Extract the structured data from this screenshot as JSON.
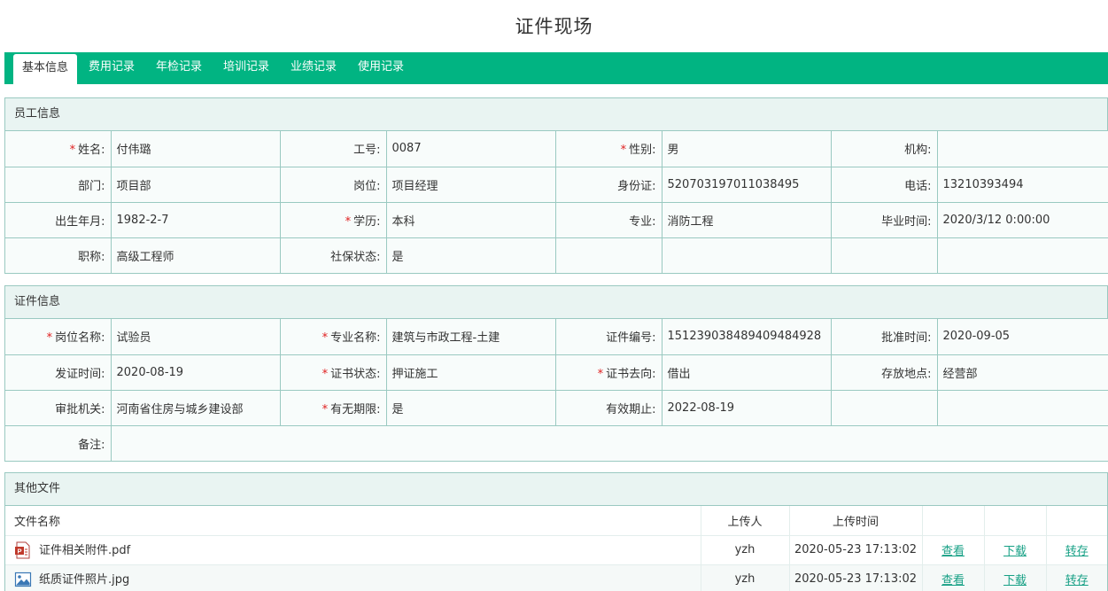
{
  "page": {
    "title": "证件现场"
  },
  "tabs": [
    {
      "label": "基本信息"
    },
    {
      "label": "费用记录"
    },
    {
      "label": "年检记录"
    },
    {
      "label": "培训记录"
    },
    {
      "label": "业绩记录"
    },
    {
      "label": "使用记录"
    }
  ],
  "employee": {
    "title": "员工信息",
    "rows": [
      [
        {
          "label": "姓名:",
          "value": "付伟璐",
          "required": true
        },
        {
          "label": "工号:",
          "value": "0087"
        },
        {
          "label": "性别:",
          "value": "男",
          "required": true
        },
        {
          "label": "机构:",
          "value": ""
        }
      ],
      [
        {
          "label": "部门:",
          "value": "项目部"
        },
        {
          "label": "岗位:",
          "value": "项目经理"
        },
        {
          "label": "身份证:",
          "value": "520703197011038495"
        },
        {
          "label": "电话:",
          "value": "13210393494"
        }
      ],
      [
        {
          "label": "出生年月:",
          "value": "1982-2-7"
        },
        {
          "label": "学历:",
          "value": "本科",
          "required": true
        },
        {
          "label": "专业:",
          "value": "消防工程"
        },
        {
          "label": "毕业时间:",
          "value": "2020/3/12 0:00:00"
        }
      ],
      [
        {
          "label": "职称:",
          "value": "高级工程师"
        },
        {
          "label": "社保状态:",
          "value": "是"
        },
        {
          "label": "",
          "value": ""
        },
        {
          "label": "",
          "value": ""
        }
      ]
    ]
  },
  "certificate": {
    "title": "证件信息",
    "rows": [
      [
        {
          "label": "岗位名称:",
          "value": "试验员",
          "required": true
        },
        {
          "label": "专业名称:",
          "value": "建筑与市政工程-土建",
          "required": true
        },
        {
          "label": "证件编号:",
          "value": "15123903848940948492​8"
        },
        {
          "label": "批准时间:",
          "value": "2020-09-05"
        }
      ],
      [
        {
          "label": "发证时间:",
          "value": "2020-08-19"
        },
        {
          "label": "证书状态:",
          "value": "押证施工",
          "required": true
        },
        {
          "label": "证书去向:",
          "value": "借出",
          "required": true
        },
        {
          "label": "存放地点:",
          "value": "经营部"
        }
      ],
      [
        {
          "label": "审批机关:",
          "value": "河南省住房与城乡建设部"
        },
        {
          "label": "有无期限:",
          "value": "是",
          "required": true
        },
        {
          "label": "有效期止:",
          "value": "2022-08-19"
        },
        {
          "label": "",
          "value": ""
        }
      ]
    ],
    "remark": {
      "label": "备注:",
      "value": ""
    }
  },
  "files": {
    "title": "其他文件",
    "headers": {
      "name": "文件名称",
      "uploader": "上传人",
      "time": "上传时间"
    },
    "rows": [
      {
        "name": "证件相关附件.pdf",
        "type": "pdf-file-icon",
        "uploader": "yzh",
        "time": "2020-05-23 17:13:02",
        "view": "查看",
        "download": "下载",
        "transfer": "转存"
      },
      {
        "name": "纸质证件照片.jpg",
        "type": "image-file-icon",
        "uploader": "yzh",
        "time": "2020-05-23 17:13:02",
        "view": "查看",
        "download": "下载",
        "transfer": "转存"
      }
    ]
  },
  "colors": {
    "accent": "#01b482",
    "border": "#9ac9c1",
    "panel_head": "#e9f4f2",
    "required": "#e02020",
    "link": "#16a085"
  }
}
